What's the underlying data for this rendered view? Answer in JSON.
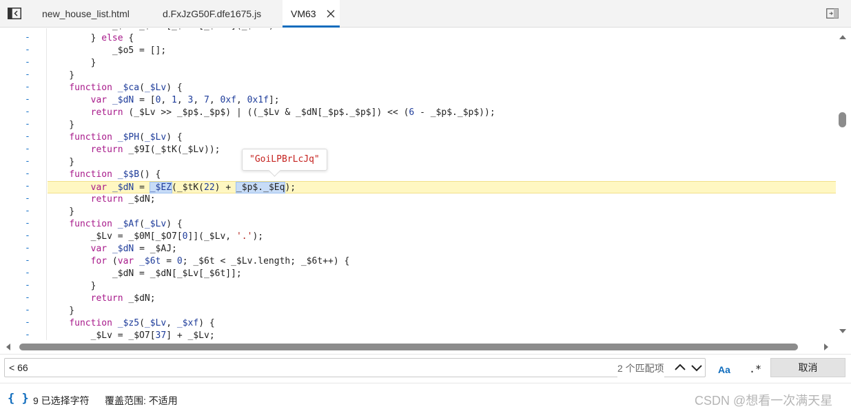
{
  "tabs": [
    {
      "label": "new_house_list.html",
      "active": false
    },
    {
      "label": "d.FxJzG50F.dfe1675.js",
      "active": false
    },
    {
      "label": "VM63",
      "active": true
    }
  ],
  "code_lines": [
    [
      {
        "t": "            _$..._$...[_$...[_$...](_$...)",
        "c": ""
      }
    ],
    [
      {
        "t": "        } ",
        "c": ""
      },
      {
        "t": "else",
        "c": "kw"
      },
      {
        "t": " {",
        "c": ""
      }
    ],
    [
      {
        "t": "            _$o5 = [];",
        "c": ""
      }
    ],
    [
      {
        "t": "        }",
        "c": ""
      }
    ],
    [
      {
        "t": "    }",
        "c": ""
      }
    ],
    [
      {
        "t": "    ",
        "c": ""
      },
      {
        "t": "function",
        "c": "kw"
      },
      {
        "t": " ",
        "c": ""
      },
      {
        "t": "_$ca",
        "c": "fn"
      },
      {
        "t": "(",
        "c": ""
      },
      {
        "t": "_$Lv",
        "c": "fn"
      },
      {
        "t": ") {",
        "c": ""
      }
    ],
    [
      {
        "t": "        ",
        "c": ""
      },
      {
        "t": "var",
        "c": "kw"
      },
      {
        "t": " ",
        "c": ""
      },
      {
        "t": "_$dN",
        "c": "fn"
      },
      {
        "t": " = [",
        "c": ""
      },
      {
        "t": "0",
        "c": "num"
      },
      {
        "t": ", ",
        "c": ""
      },
      {
        "t": "1",
        "c": "num"
      },
      {
        "t": ", ",
        "c": ""
      },
      {
        "t": "3",
        "c": "num"
      },
      {
        "t": ", ",
        "c": ""
      },
      {
        "t": "7",
        "c": "num"
      },
      {
        "t": ", ",
        "c": ""
      },
      {
        "t": "0xf",
        "c": "num"
      },
      {
        "t": ", ",
        "c": ""
      },
      {
        "t": "0x1f",
        "c": "num"
      },
      {
        "t": "];",
        "c": ""
      }
    ],
    [
      {
        "t": "        ",
        "c": ""
      },
      {
        "t": "return",
        "c": "kw"
      },
      {
        "t": " (_$Lv >> _$p$._$p$) | ((_$Lv & _$dN[_$p$._$p$]) << (",
        "c": ""
      },
      {
        "t": "6",
        "c": "num"
      },
      {
        "t": " - _$p$._$p$));",
        "c": ""
      }
    ],
    [
      {
        "t": "    }",
        "c": ""
      }
    ],
    [
      {
        "t": "    ",
        "c": ""
      },
      {
        "t": "function",
        "c": "kw"
      },
      {
        "t": " ",
        "c": ""
      },
      {
        "t": "_$PH",
        "c": "fn"
      },
      {
        "t": "(",
        "c": ""
      },
      {
        "t": "_$Lv",
        "c": "fn"
      },
      {
        "t": ") {",
        "c": ""
      }
    ],
    [
      {
        "t": "        ",
        "c": ""
      },
      {
        "t": "return",
        "c": "kw"
      },
      {
        "t": " _$9I(_$tK(_$Lv));",
        "c": ""
      }
    ],
    [
      {
        "t": "    }",
        "c": ""
      }
    ],
    [
      {
        "t": "    ",
        "c": ""
      },
      {
        "t": "function",
        "c": "kw"
      },
      {
        "t": " ",
        "c": ""
      },
      {
        "t": "_$$B",
        "c": "fn"
      },
      {
        "t": "() {",
        "c": ""
      }
    ],
    [
      {
        "t": "        ",
        "c": ""
      },
      {
        "t": "var",
        "c": "kw"
      },
      {
        "t": " ",
        "c": ""
      },
      {
        "t": "_$dN",
        "c": "fn"
      },
      {
        "t": " = ",
        "c": ""
      },
      {
        "t": "_$EZ",
        "c": "fn sel"
      },
      {
        "t": "(_$tK(",
        "c": ""
      },
      {
        "t": "22",
        "c": "num"
      },
      {
        "t": ") + ",
        "c": ""
      },
      {
        "t": "_$p$._$Eq",
        "c": "sel"
      },
      {
        "t": ");",
        "c": ""
      }
    ],
    [
      {
        "t": "        ",
        "c": ""
      },
      {
        "t": "return",
        "c": "kw"
      },
      {
        "t": " _$dN;",
        "c": ""
      }
    ],
    [
      {
        "t": "    }",
        "c": ""
      }
    ],
    [
      {
        "t": "    ",
        "c": ""
      },
      {
        "t": "function",
        "c": "kw"
      },
      {
        "t": " ",
        "c": ""
      },
      {
        "t": "_$Af",
        "c": "fn"
      },
      {
        "t": "(",
        "c": ""
      },
      {
        "t": "_$Lv",
        "c": "fn"
      },
      {
        "t": ") {",
        "c": ""
      }
    ],
    [
      {
        "t": "        _$Lv = _$0M[_$O7[",
        "c": ""
      },
      {
        "t": "0",
        "c": "num"
      },
      {
        "t": "]](_$Lv, ",
        "c": ""
      },
      {
        "t": "'.'",
        "c": "str"
      },
      {
        "t": ");",
        "c": ""
      }
    ],
    [
      {
        "t": "        ",
        "c": ""
      },
      {
        "t": "var",
        "c": "kw"
      },
      {
        "t": " ",
        "c": ""
      },
      {
        "t": "_$dN",
        "c": "fn"
      },
      {
        "t": " = _$AJ;",
        "c": ""
      }
    ],
    [
      {
        "t": "        ",
        "c": ""
      },
      {
        "t": "for",
        "c": "kw"
      },
      {
        "t": " (",
        "c": ""
      },
      {
        "t": "var",
        "c": "kw"
      },
      {
        "t": " ",
        "c": ""
      },
      {
        "t": "_$6t",
        "c": "fn"
      },
      {
        "t": " = ",
        "c": ""
      },
      {
        "t": "0",
        "c": "num"
      },
      {
        "t": "; _$6t < _$Lv.length; _$6t++) {",
        "c": ""
      }
    ],
    [
      {
        "t": "            _$dN = _$dN[_$Lv[_$6t]];",
        "c": ""
      }
    ],
    [
      {
        "t": "        }",
        "c": ""
      }
    ],
    [
      {
        "t": "        ",
        "c": ""
      },
      {
        "t": "return",
        "c": "kw"
      },
      {
        "t": " _$dN;",
        "c": ""
      }
    ],
    [
      {
        "t": "    }",
        "c": ""
      }
    ],
    [
      {
        "t": "    ",
        "c": ""
      },
      {
        "t": "function",
        "c": "kw"
      },
      {
        "t": " ",
        "c": ""
      },
      {
        "t": "_$z5",
        "c": "fn"
      },
      {
        "t": "(",
        "c": ""
      },
      {
        "t": "_$Lv",
        "c": "fn"
      },
      {
        "t": ", ",
        "c": ""
      },
      {
        "t": "_$xf",
        "c": "fn"
      },
      {
        "t": ") {",
        "c": ""
      }
    ],
    [
      {
        "t": "        _$Lv = _$O7[",
        "c": ""
      },
      {
        "t": "37",
        "c": "num"
      },
      {
        "t": "] + _$Lv;",
        "c": ""
      }
    ]
  ],
  "gutter_marker": "-",
  "tooltip": {
    "text": "\"GoiLPBrLcJq\""
  },
  "search": {
    "value": "< 66",
    "match_count": "2 个匹配项",
    "case_label": "Aa",
    "regex_label": ".*",
    "cancel_label": "取消"
  },
  "status": {
    "braces_label": "{ }",
    "selected": "9 已选择字符",
    "coverage": "覆盖范围: 不适用"
  },
  "watermark": "CSDN @想看一次满天星",
  "colors": {
    "accent": "#0f6cbd",
    "highlight_line": "#fff7c2",
    "selection": "#c7dcf7"
  }
}
